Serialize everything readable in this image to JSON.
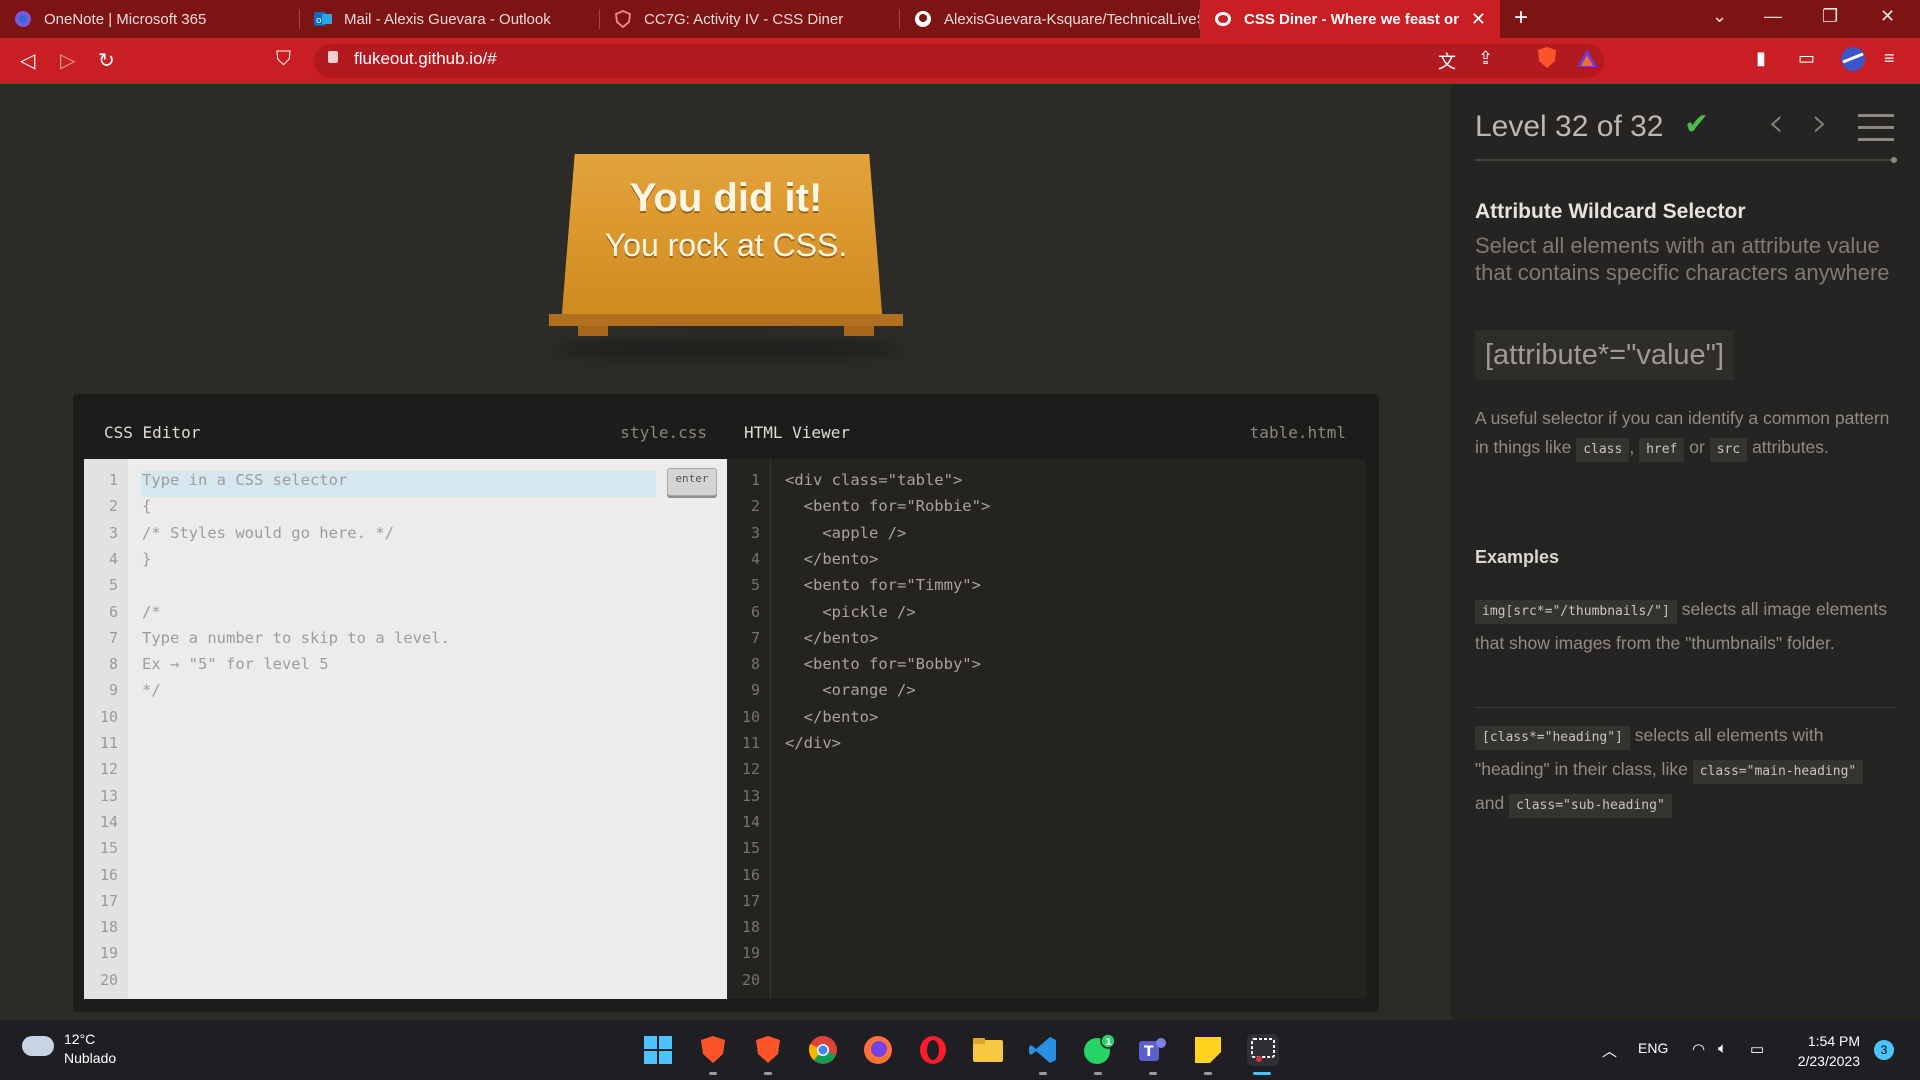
{
  "browser": {
    "tabs": [
      {
        "title": "OneNote | Microsoft 365",
        "icon": "onenote-icon"
      },
      {
        "title": "Mail - Alexis Guevara - Outlook",
        "icon": "outlook-icon"
      },
      {
        "title": "CC7G: Activity IV - CSS Diner",
        "icon": "shield-icon"
      },
      {
        "title": "AlexisGuevara-Ksquare/TechnicalLiveS",
        "icon": "github-icon"
      },
      {
        "title": "CSS Diner - Where we feast on CS",
        "icon": "css-diner-icon",
        "active": true
      }
    ],
    "new_tab": "+",
    "url": "flukeout.github.io/#"
  },
  "colors": {
    "chrome": "#c91f24",
    "tab_strip": "#7c1414",
    "accent_check": "#4cbb4c",
    "table": "#d8962b"
  },
  "win": {
    "line1": "You did it!",
    "line2": "You rock at CSS."
  },
  "editor": {
    "css_title": "CSS Editor",
    "css_file": "style.css",
    "html_title": "HTML Viewer",
    "html_file": "table.html",
    "enter_label": "enter",
    "css_lines": [
      "Type in a CSS selector",
      "{",
      "/* Styles would go here. */",
      "}",
      "",
      "/*",
      "Type a number to skip to a level.",
      "Ex → \"5\" for level 5",
      "*/"
    ],
    "html_lines": [
      "<div class=\"table\">",
      "  <bento for=\"Robbie\">",
      "    <apple />",
      "  </bento>",
      "  <bento for=\"Timmy\">",
      "    <pickle />",
      "  </bento>",
      "  <bento for=\"Bobby\">",
      "    <orange />",
      "  </bento>",
      "</div>"
    ],
    "line_count": 20
  },
  "sidebar": {
    "level": "Level 32 of 32",
    "title": "Attribute Wildcard Selector",
    "description": "Select all elements with an attribute value that contains specific characters anywhere",
    "syntax": "[attribute*=\"value\"]",
    "hint_before": "A useful selector if you can identify a common pattern in things like",
    "hint_chip1": "class",
    "hint_sep": ",",
    "hint_chip2": "href",
    "hint_or": "or",
    "hint_chip3": "src",
    "hint_after": "attributes.",
    "examples_title": "Examples",
    "ex1_code": "img[src*=\"/thumbnails/\"]",
    "ex1_text": "selects all image elements that show images from the \"thumbnails\" folder.",
    "ex2_code": "[class*=\"heading\"]",
    "ex2_text1": "selects all elements with \"heading\" in their class, like",
    "ex2_code2": "class=\"main-heading\"",
    "ex2_and": "and",
    "ex2_code3": "class=\"sub-heading\""
  },
  "taskbar": {
    "temp": "12°C",
    "weather": "Nublado",
    "lang": "ENG",
    "time": "1:54 PM",
    "date": "2/23/2023",
    "notifications": "3",
    "whatsapp_badge": "1"
  }
}
